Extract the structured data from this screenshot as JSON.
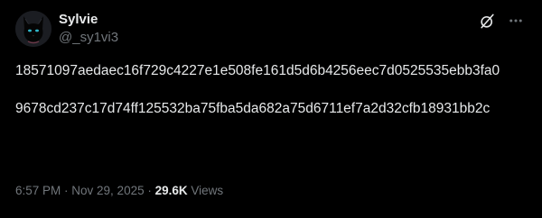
{
  "author": {
    "display_name": "Sylvie",
    "handle": "@_sy1vi3"
  },
  "actions": {
    "grok_icon": "grok-icon",
    "more_icon": "more-horizontal-icon"
  },
  "post": {
    "paragraphs": [
      "18571097aedaec16f729c4227e1e508fe161d5d6b4256eec7d0525535ebb3fa0",
      "9678cd237c17d74ff125532ba75fba5da682a75d6711ef7a2d32cfb18931bb2c"
    ]
  },
  "meta": {
    "time": "6:57 PM",
    "separator_1": " · ",
    "date": "Nov 29, 2025",
    "separator_2": " · ",
    "views_count": "29.6K",
    "views_label": " Views"
  },
  "colors": {
    "background": "#000000",
    "text_primary": "#e7e9ea",
    "text_secondary": "#71767b"
  }
}
